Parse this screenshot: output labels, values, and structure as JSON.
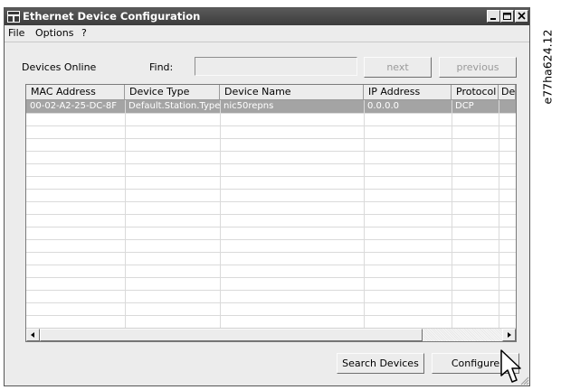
{
  "window": {
    "title": "Ethernet Device Configuration"
  },
  "menu": {
    "file": "File",
    "options": "Options",
    "help": "?"
  },
  "toolbar": {
    "devices_online_label": "Devices Online",
    "find_label": "Find:",
    "find_value": "",
    "next_label": "next",
    "previous_label": "previous"
  },
  "table": {
    "columns": [
      "MAC Address",
      "Device Type",
      "Device Name",
      "IP Address",
      "Protocol",
      "De"
    ],
    "rows": [
      {
        "mac": "00-02-A2-25-DC-8F",
        "type": "Default.Station.Type",
        "name": "nic50repns",
        "ip": "0.0.0.0",
        "protocol": "DCP",
        "extra": ""
      }
    ]
  },
  "buttons": {
    "search_devices": "Search Devices",
    "configure": "Configure"
  },
  "figure_code": "e77ha624.12"
}
